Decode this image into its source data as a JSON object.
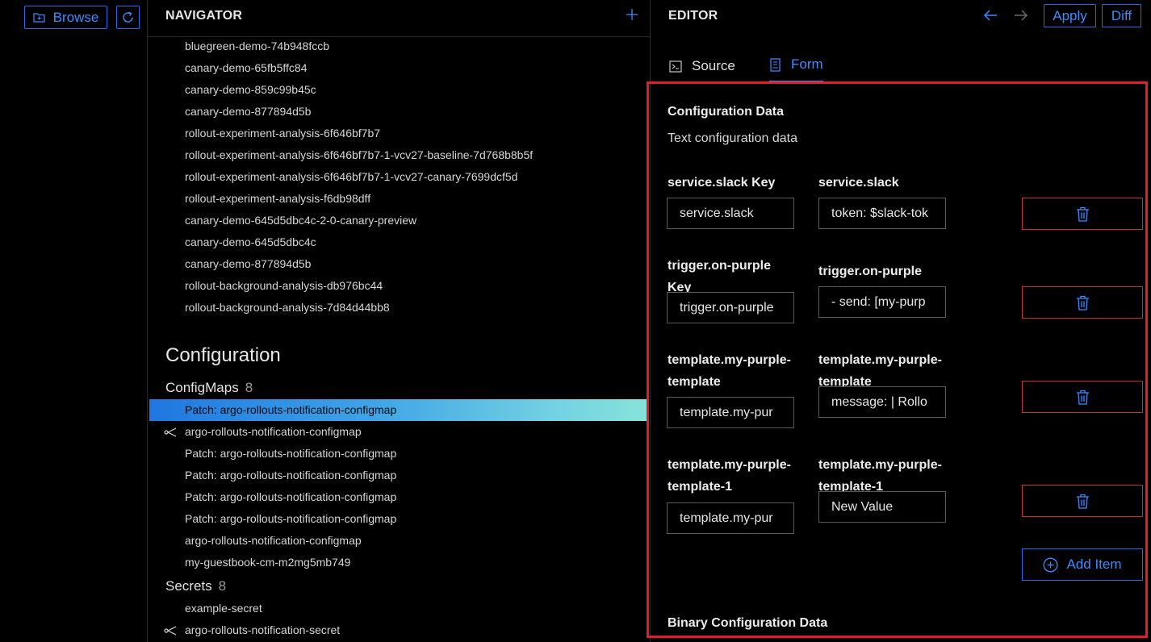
{
  "toolbar": {
    "browse_label": "Browse"
  },
  "navigator": {
    "title": "NAVIGATOR",
    "top_items": [
      "bluegreen-demo-74b948fccb",
      "canary-demo-65fb5ffc84",
      "canary-demo-859c99b45c",
      "canary-demo-877894d5b",
      "rollout-experiment-analysis-6f646bf7b7",
      "rollout-experiment-analysis-6f646bf7b7-1-vcv27-baseline-7d768b8b5f",
      "rollout-experiment-analysis-6f646bf7b7-1-vcv27-canary-7699dcf5d",
      "rollout-experiment-analysis-f6db98dff",
      "canary-demo-645d5dbc4c-2-0-canary-preview",
      "canary-demo-645d5dbc4c",
      "canary-demo-877894d5b",
      "rollout-background-analysis-db976bc44",
      "rollout-background-analysis-7d84d44bb8"
    ],
    "section_title": "Configuration",
    "configmaps": {
      "label": "ConfigMaps",
      "count": "8",
      "items": [
        "Patch: argo-rollouts-notification-configmap",
        "argo-rollouts-notification-configmap",
        "Patch: argo-rollouts-notification-configmap",
        "Patch: argo-rollouts-notification-configmap",
        "Patch: argo-rollouts-notification-configmap",
        "Patch: argo-rollouts-notification-configmap",
        "argo-rollouts-notification-configmap",
        "my-guestbook-cm-m2mg5mb749"
      ]
    },
    "secrets": {
      "label": "Secrets",
      "count": "8",
      "items": [
        "example-secret",
        "argo-rollouts-notification-secret"
      ]
    }
  },
  "editor": {
    "title": "EDITOR",
    "apply_label": "Apply",
    "diff_label": "Diff",
    "tabs": {
      "source": "Source",
      "form": "Form"
    },
    "form": {
      "config_title": "Configuration Data",
      "config_subtitle": "Text configuration data",
      "rows": [
        {
          "key_label": "service.slack Key",
          "value_label": "service.slack",
          "key_value": "service.slack",
          "value": "token: $slack-tok"
        },
        {
          "key_label": "trigger.on-purple Key",
          "value_label": "trigger.on-purple",
          "key_value": "trigger.on-purple",
          "value": "- send: [my-purp"
        },
        {
          "key_label": "template.my-purple-template",
          "value_label": "template.my-purple-template",
          "key_value": "template.my-pur",
          "value": "message: |  Rollo"
        },
        {
          "key_label": "template.my-purple-template-1",
          "value_label": "template.my-purple-template-1",
          "key_value": "template.my-pur",
          "value": "New Value"
        }
      ],
      "add_item_label": "Add Item",
      "binary_title": "Binary Configuration Data"
    }
  },
  "colors": {
    "accent": "#3b8cff",
    "highlight_border": "#e01e2a",
    "delete_border": "#c2332f"
  }
}
